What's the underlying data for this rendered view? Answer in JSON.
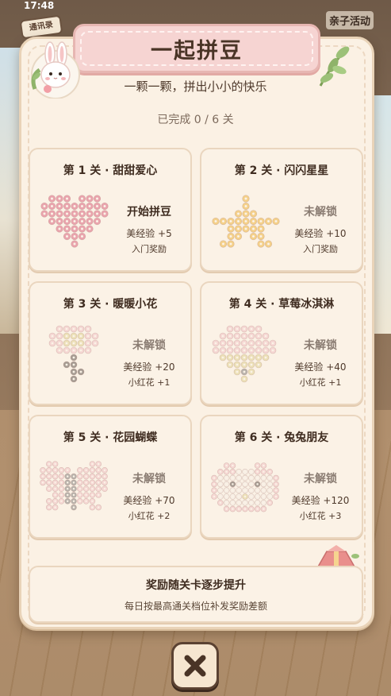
{
  "status_bar": {
    "time": "17:48"
  },
  "badges": {
    "top_left": "通讯录",
    "top_right": "亲子活动"
  },
  "header": {
    "title": "一起拼豆",
    "subtitle": "一颗一颗，拼出小小的快乐",
    "progress": "已完成 0 / 6 关"
  },
  "levels": [
    {
      "title": "第 1 关 · 甜甜爱心",
      "status": "开始拼豆",
      "reward1": "美经验 +5",
      "reward2": "入门奖励",
      "locked": false,
      "icon": "heart-bead-pattern"
    },
    {
      "title": "第 2 关 · 闪闪星星",
      "status": "未解锁",
      "reward1": "美经验 +10",
      "reward2": "入门奖励",
      "locked": true,
      "icon": "star-bead-pattern"
    },
    {
      "title": "第 3 关 · 暖暖小花",
      "status": "未解锁",
      "reward1": "美经验 +20",
      "reward2": "小红花 +1",
      "locked": true,
      "icon": "flower-bead-pattern"
    },
    {
      "title": "第 4 关 · 草莓冰淇淋",
      "status": "未解锁",
      "reward1": "美经验 +40",
      "reward2": "小红花 +1",
      "locked": true,
      "icon": "ice-cream-bead-pattern"
    },
    {
      "title": "第 5 关 · 花园蝴蝶",
      "status": "未解锁",
      "reward1": "美经验 +70",
      "reward2": "小红花 +2",
      "locked": true,
      "icon": "butterfly-bead-pattern"
    },
    {
      "title": "第 6 关 · 兔兔朋友",
      "status": "未解锁",
      "reward1": "美经验 +120",
      "reward2": "小红花 +3",
      "locked": true,
      "icon": "bunny-bead-pattern"
    }
  ],
  "footer": {
    "title": "奖励随关卡逐步提升",
    "subtitle": "每日按最高通关档位补发奖励差额"
  },
  "colors": {
    "panel_bg": "#fbf1e4",
    "ribbon": "#f6d4d2",
    "text_dark": "#3f2c20",
    "locked_text": "#8a7c72",
    "bead_pink": "#e9a4ad",
    "bead_yellow": "#f4d08a"
  }
}
